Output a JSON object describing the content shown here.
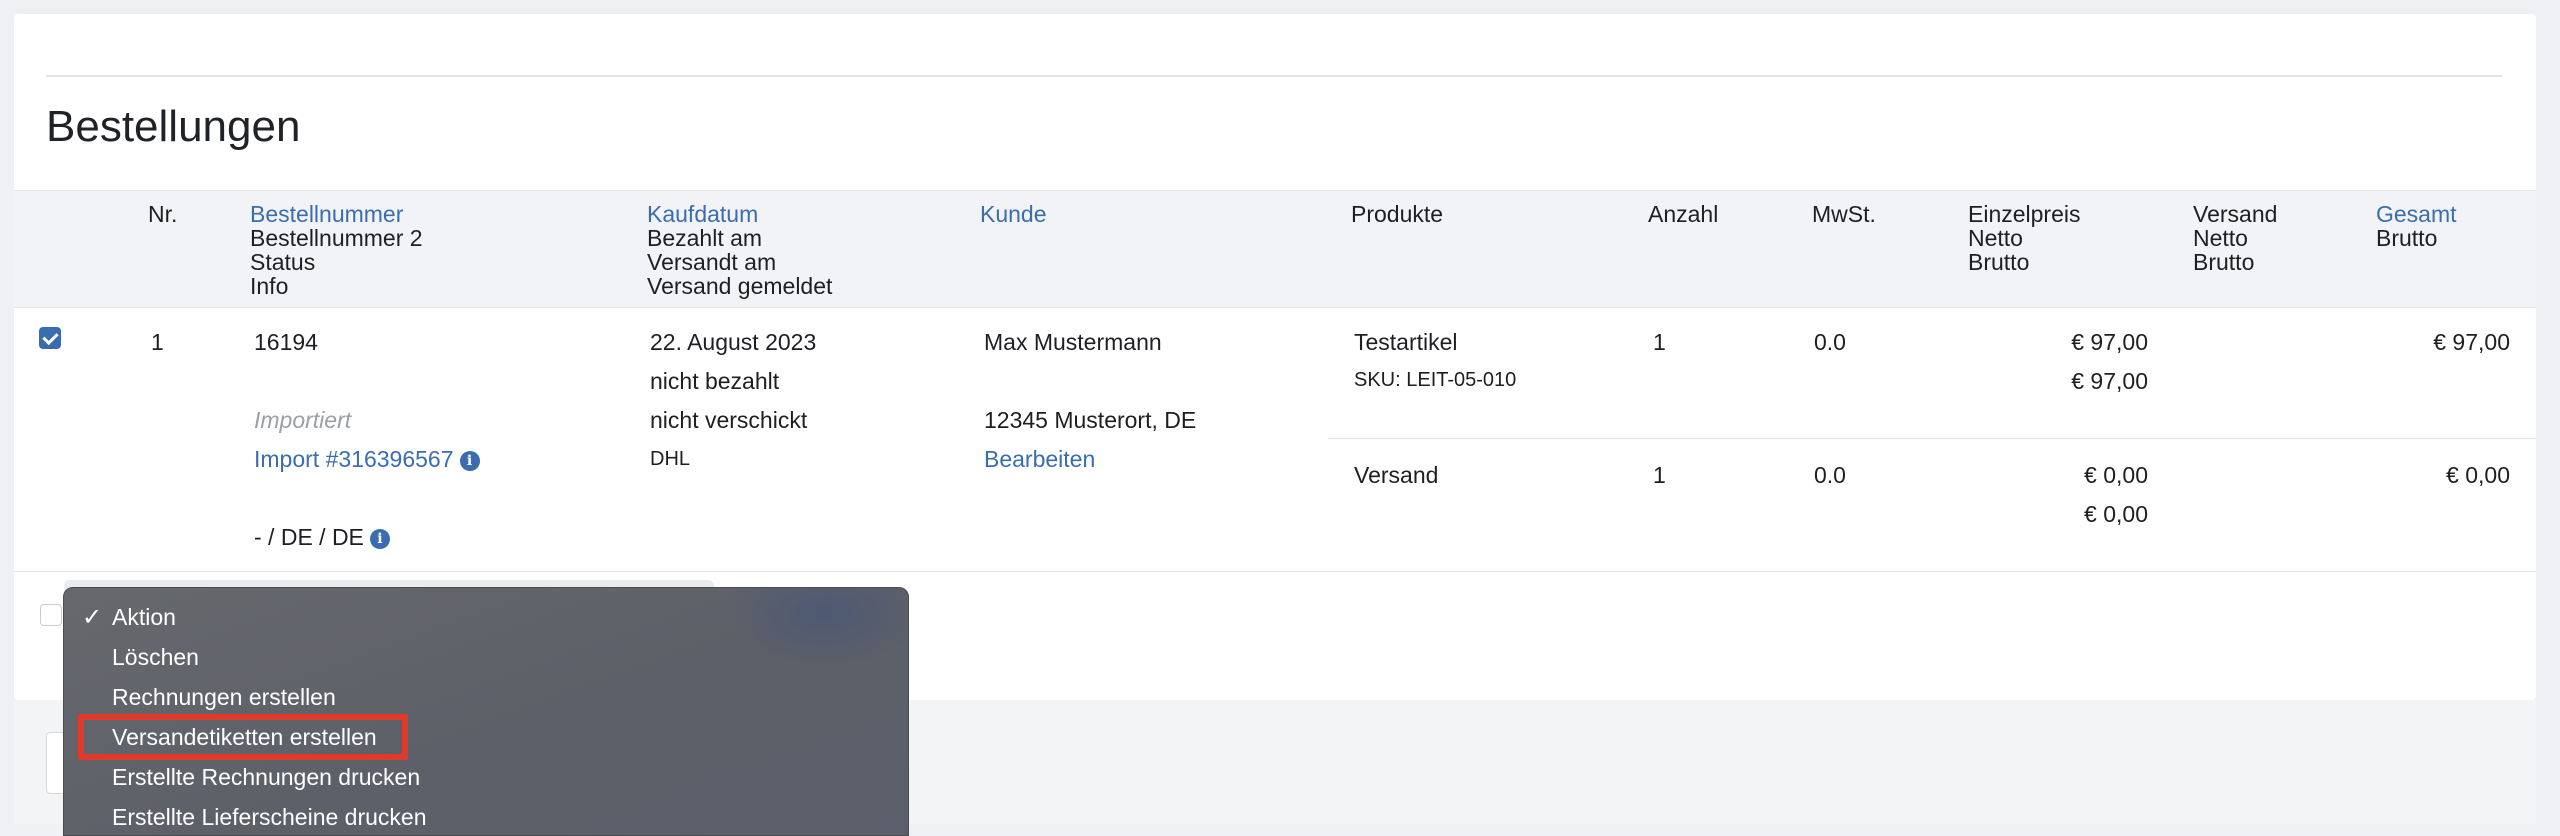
{
  "page": {
    "title": "Bestellungen"
  },
  "table": {
    "headers": {
      "nr": "Nr.",
      "bestellnummer": [
        "Bestellnummer",
        "Bestellnummer 2",
        "Status",
        "Info"
      ],
      "kaufdatum": [
        "Kaufdatum",
        "Bezahlt am",
        "Versandt am",
        "Versand gemeldet"
      ],
      "kunde": "Kunde",
      "produkte": "Produkte",
      "anzahl": "Anzahl",
      "mwst": "MwSt.",
      "einzelpreis": [
        "Einzelpreis",
        "Netto",
        "Brutto"
      ],
      "versand": [
        "Versand",
        "Netto",
        "Brutto"
      ],
      "gesamt": [
        "Gesamt",
        "Brutto"
      ]
    },
    "row": {
      "checked": true,
      "nr": "1",
      "order_number": "16194",
      "status": "Importiert",
      "import_info": "Import #316396567",
      "country_info": "- / DE / DE",
      "kaufdatum": "22. August 2023",
      "bezahlt": "nicht bezahlt",
      "versandt": "nicht verschickt",
      "carrier": "DHL",
      "customer_name": "Max Mustermann",
      "customer_address": "12345 Musterort, DE",
      "edit_link": "Bearbeiten",
      "items": [
        {
          "product": "Testartikel",
          "sku": "SKU: LEIT-05-010",
          "qty": "1",
          "vat": "0.0",
          "price_net": "€ 97,00",
          "price_gross": "€ 97,00",
          "total": "€ 97,00"
        },
        {
          "product": "Versand",
          "sku": "",
          "qty": "1",
          "vat": "0.0",
          "price_net": "€ 0,00",
          "price_gross": "€ 0,00",
          "total": "€ 0,00"
        }
      ]
    }
  },
  "bulk_action": {
    "options": [
      {
        "label": "Aktion",
        "selected": true
      },
      {
        "label": "Löschen"
      },
      {
        "label": "Rechnungen erstellen"
      },
      {
        "label": "Versandetiketten erstellen",
        "highlighted": true
      },
      {
        "label": "Erstellte Rechnungen drucken"
      },
      {
        "label": "Erstellte Lieferscheine drucken"
      }
    ]
  },
  "colors": {
    "link": "#3a6db0",
    "highlight": "#e1392b",
    "dropdown_bg": "#616369"
  }
}
